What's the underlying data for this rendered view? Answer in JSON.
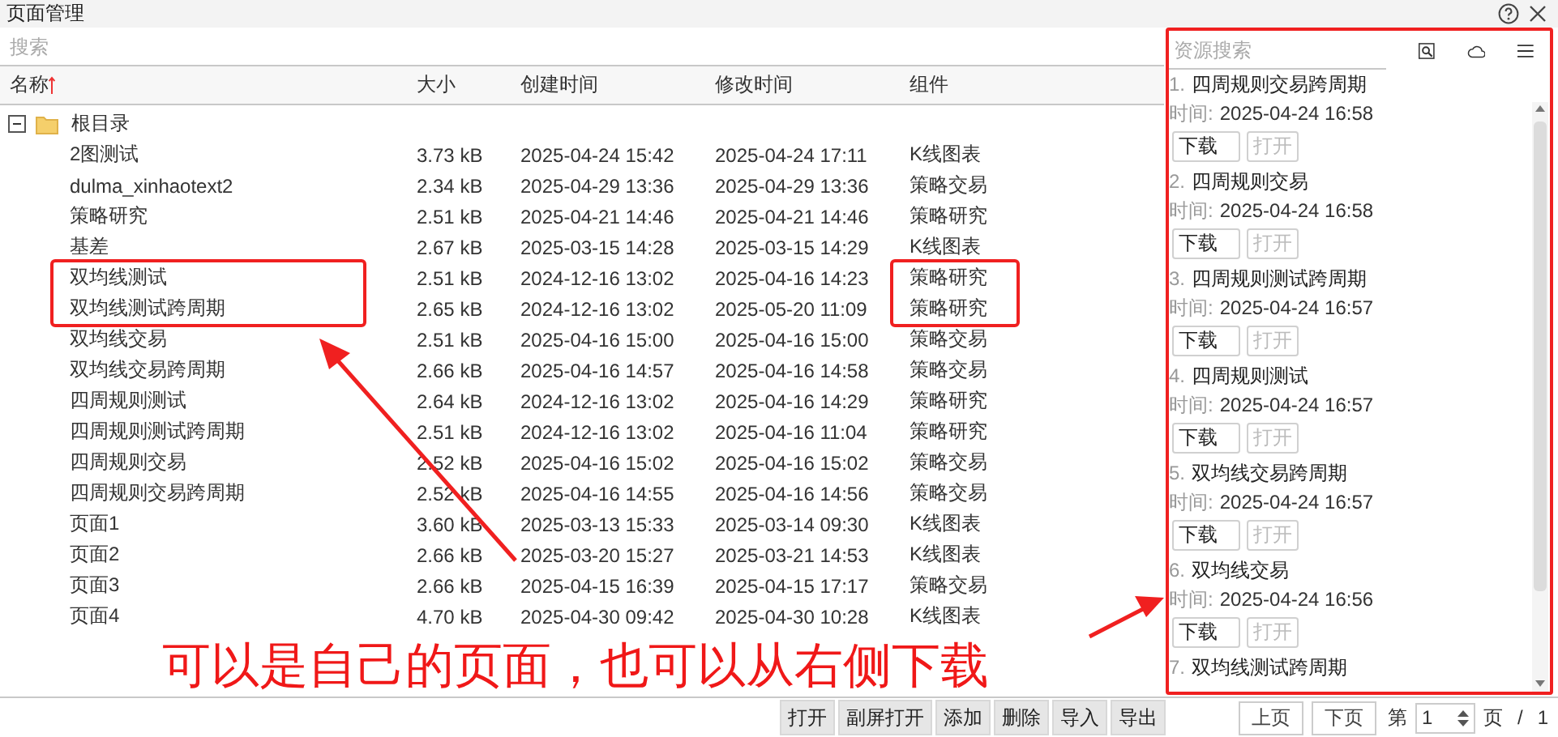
{
  "window": {
    "title": "页面管理"
  },
  "search": {
    "placeholder": "搜索"
  },
  "table": {
    "columns": [
      {
        "label": "名称",
        "sorted": true
      },
      {
        "label": "大小",
        "sorted": false
      },
      {
        "label": "创建时间",
        "sorted": false
      },
      {
        "label": "修改时间",
        "sorted": false
      },
      {
        "label": "组件",
        "sorted": false
      }
    ],
    "tree": {
      "label": "根目录",
      "expanded": true,
      "children": [
        {
          "name": "2图测试",
          "size": "3.73 kB",
          "created": "2025-04-24 15:42",
          "modified": "2025-04-24 17:11",
          "component": "K线图表",
          "highlighted": false
        },
        {
          "name": "dulma_xinhaotext2",
          "size": "2.34 kB",
          "created": "2025-04-29 13:36",
          "modified": "2025-04-29 13:36",
          "component": "策略交易",
          "highlighted": false
        },
        {
          "name": "策略研究",
          "size": "2.51 kB",
          "created": "2025-04-21 14:46",
          "modified": "2025-04-21 14:46",
          "component": "策略研究",
          "highlighted": false
        },
        {
          "name": "基差",
          "size": "2.67 kB",
          "created": "2025-03-15 14:28",
          "modified": "2025-03-15 14:29",
          "component": "K线图表",
          "highlighted": false
        },
        {
          "name": "双均线测试",
          "size": "2.51 kB",
          "created": "2024-12-16 13:02",
          "modified": "2025-04-16 14:23",
          "component": "策略研究",
          "highlighted": true
        },
        {
          "name": "双均线测试跨周期",
          "size": "2.65 kB",
          "created": "2024-12-16 13:02",
          "modified": "2025-05-20 11:09",
          "component": "策略研究",
          "highlighted": true
        },
        {
          "name": "双均线交易",
          "size": "2.51 kB",
          "created": "2025-04-16 15:00",
          "modified": "2025-04-16 15:00",
          "component": "策略交易",
          "highlighted": false
        },
        {
          "name": "双均线交易跨周期",
          "size": "2.66 kB",
          "created": "2025-04-16 14:57",
          "modified": "2025-04-16 14:58",
          "component": "策略交易",
          "highlighted": false
        },
        {
          "name": "四周规则测试",
          "size": "2.64 kB",
          "created": "2024-12-16 13:02",
          "modified": "2025-04-16 14:29",
          "component": "策略研究",
          "highlighted": false
        },
        {
          "name": "四周规则测试跨周期",
          "size": "2.51 kB",
          "created": "2024-12-16 13:02",
          "modified": "2025-04-16 11:04",
          "component": "策略研究",
          "highlighted": false
        },
        {
          "name": "四周规则交易",
          "size": "2.52 kB",
          "created": "2025-04-16 15:02",
          "modified": "2025-04-16 15:02",
          "component": "策略交易",
          "highlighted": false
        },
        {
          "name": "四周规则交易跨周期",
          "size": "2.52 kB",
          "created": "2025-04-16 14:55",
          "modified": "2025-04-16 14:56",
          "component": "策略交易",
          "highlighted": false
        },
        {
          "name": "页面1",
          "size": "3.60 kB",
          "created": "2025-03-13 15:33",
          "modified": "2025-03-14 09:30",
          "component": "K线图表",
          "highlighted": false
        },
        {
          "name": "页面2",
          "size": "2.66 kB",
          "created": "2025-03-20 15:27",
          "modified": "2025-03-21 14:53",
          "component": "K线图表",
          "highlighted": false
        },
        {
          "name": "页面3",
          "size": "2.66 kB",
          "created": "2025-04-15 16:39",
          "modified": "2025-04-15 17:17",
          "component": "策略交易",
          "highlighted": false
        },
        {
          "name": "页面4",
          "size": "4.70 kB",
          "created": "2025-04-30 09:42",
          "modified": "2025-04-30 10:28",
          "component": "K线图表",
          "highlighted": false
        }
      ]
    }
  },
  "annotation": {
    "caption": "可以是自己的页面，也可以从右侧下载"
  },
  "resource_panel": {
    "highlighted": true,
    "search": {
      "placeholder": "资源搜索"
    },
    "items": [
      {
        "index": "1.",
        "title": "四周规则交易跨周期",
        "time_label": "时间:",
        "time": "2025-04-24 16:58",
        "buttons": [
          {
            "label": "下载",
            "disabled": false
          },
          {
            "label": "打开",
            "disabled": true
          }
        ]
      },
      {
        "index": "2.",
        "title": "四周规则交易",
        "time_label": "时间:",
        "time": "2025-04-24 16:58",
        "buttons": [
          {
            "label": "下载",
            "disabled": false
          },
          {
            "label": "打开",
            "disabled": true
          }
        ]
      },
      {
        "index": "3.",
        "title": "四周规则测试跨周期",
        "time_label": "时间:",
        "time": "2025-04-24 16:57",
        "buttons": [
          {
            "label": "下载",
            "disabled": false
          },
          {
            "label": "打开",
            "disabled": true
          }
        ]
      },
      {
        "index": "4.",
        "title": "四周规则测试",
        "time_label": "时间:",
        "time": "2025-04-24 16:57",
        "buttons": [
          {
            "label": "下载",
            "disabled": false
          },
          {
            "label": "打开",
            "disabled": true
          }
        ]
      },
      {
        "index": "5.",
        "title": "双均线交易跨周期",
        "time_label": "时间:",
        "time": "2025-04-24 16:57",
        "buttons": [
          {
            "label": "下载",
            "disabled": false
          },
          {
            "label": "打开",
            "disabled": true
          }
        ]
      },
      {
        "index": "6.",
        "title": "双均线交易",
        "time_label": "时间:",
        "time": "2025-04-24 16:56",
        "buttons": [
          {
            "label": "下载",
            "disabled": false
          },
          {
            "label": "打开",
            "disabled": true
          }
        ]
      },
      {
        "index": "7.",
        "title": "双均线测试跨周期"
      }
    ]
  },
  "toolbar": {
    "buttons": [
      "打开",
      "副屏打开",
      "添加",
      "删除",
      "导入",
      "导出"
    ]
  },
  "pager": {
    "prev": "上页",
    "next": "下页",
    "page_prefix": "第",
    "page": "1",
    "page_suffix": "页",
    "separator": "/",
    "total": "1"
  }
}
